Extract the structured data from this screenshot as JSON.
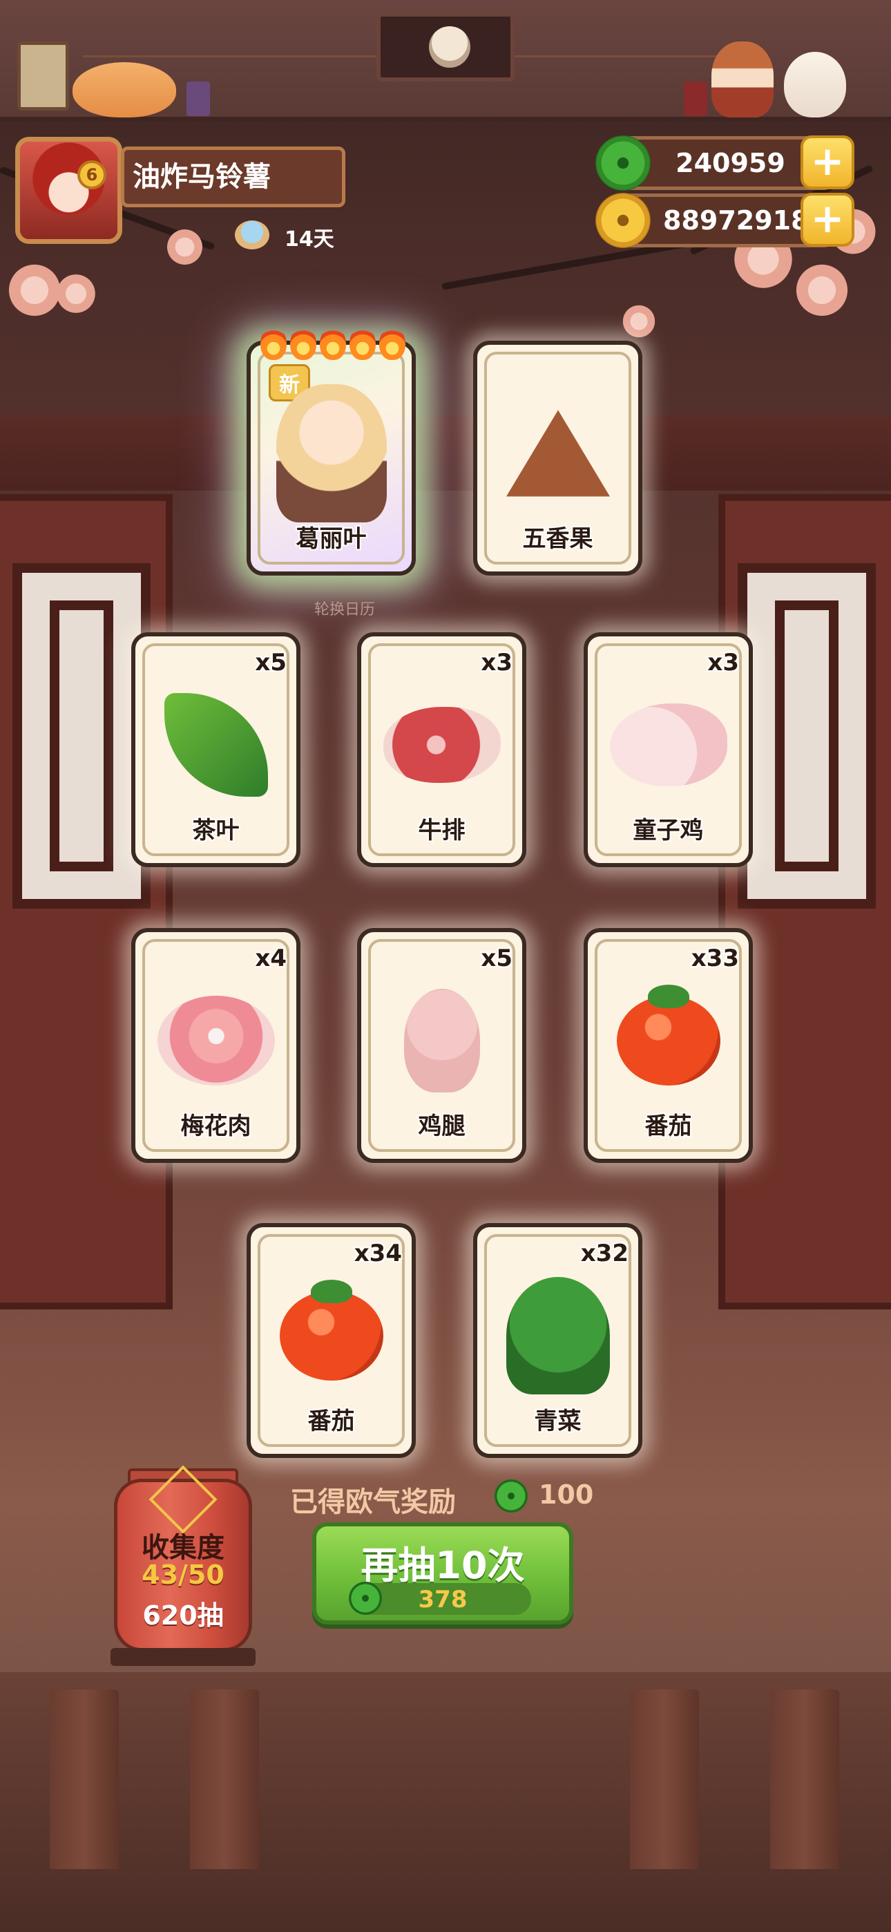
{
  "player": {
    "name": "油炸马铃薯",
    "level": "6",
    "days": "14天"
  },
  "currency": {
    "jade": "240959",
    "gold": "88972918",
    "add_symbol": "+"
  },
  "cards": [
    {
      "name": "葛丽叶",
      "qty": "",
      "new_label": "新",
      "art": "character-portrait"
    },
    {
      "name": "五香果",
      "qty": "",
      "art": "spice-fruit-icon"
    },
    {
      "name": "茶叶",
      "qty": "x5",
      "art": "tea-leaf-icon"
    },
    {
      "name": "牛排",
      "qty": "x3",
      "art": "steak-icon"
    },
    {
      "name": "童子鸡",
      "qty": "x3",
      "art": "chicken-icon"
    },
    {
      "name": "梅花肉",
      "qty": "x4",
      "art": "pork-icon"
    },
    {
      "name": "鸡腿",
      "qty": "x5",
      "art": "drumstick-icon"
    },
    {
      "name": "番茄",
      "qty": "x33",
      "art": "tomato-icon"
    },
    {
      "name": "番茄",
      "qty": "x34",
      "art": "tomato-icon"
    },
    {
      "name": "青菜",
      "qty": "x32",
      "art": "greens-icon"
    }
  ],
  "calendar_label": "轮换日历",
  "bonus": {
    "label": "已得欧气奖励",
    "value": "100"
  },
  "redraw": {
    "label": "再抽10次",
    "cost": "378"
  },
  "collection": {
    "title": "收集度",
    "progress": "43/50",
    "draws": "620抽"
  },
  "colors": {
    "button_green": "#6fbf3a",
    "gold_text": "#f5c842",
    "card_bg": "#fcf3e2"
  }
}
